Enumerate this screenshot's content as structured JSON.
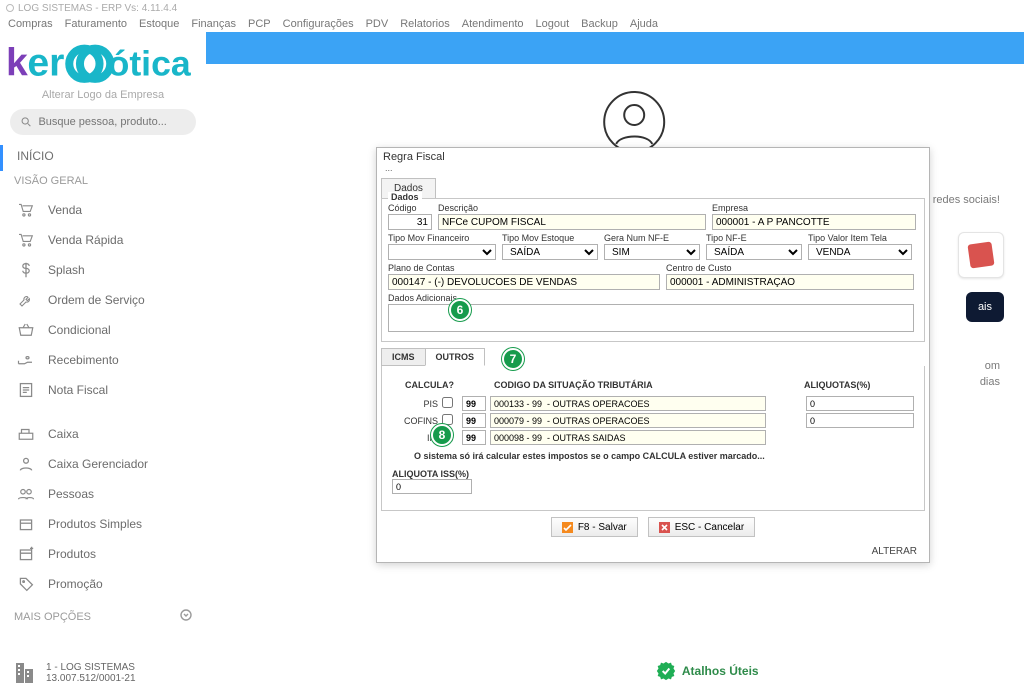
{
  "window_title": "LOG SISTEMAS - ERP Vs: 4.11.4.4",
  "menubar": [
    "Compras",
    "Faturamento",
    "Estoque",
    "Finanças",
    "PCP",
    "Configurações",
    "PDV",
    "Relatorios",
    "Atendimento",
    "Logout",
    "Backup",
    "Ajuda"
  ],
  "sidebar": {
    "alter_logo": "Alterar Logo da Empresa",
    "search_placeholder": "Busque pessoa, produto...",
    "inicio": "INÍCIO",
    "visao_geral": "VISÃO GERAL",
    "items1": [
      {
        "icon": "cart",
        "label": "Venda"
      },
      {
        "icon": "cart",
        "label": "Venda Rápida"
      },
      {
        "icon": "dollar",
        "label": "Splash"
      },
      {
        "icon": "wrench",
        "label": "Ordem de Serviço"
      },
      {
        "icon": "basket",
        "label": "Condicional"
      },
      {
        "icon": "hand-dollar",
        "label": "Recebimento"
      },
      {
        "icon": "receipt",
        "label": "Nota Fiscal"
      }
    ],
    "items2": [
      {
        "icon": "register",
        "label": "Caixa"
      },
      {
        "icon": "person",
        "label": "Caixa Gerenciador"
      },
      {
        "icon": "people",
        "label": "Pessoas"
      },
      {
        "icon": "box",
        "label": "Produtos Simples"
      },
      {
        "icon": "box-plus",
        "label": "Produtos"
      },
      {
        "icon": "tag",
        "label": "Promoção"
      }
    ],
    "mais_opcoes": "MAIS OPÇÕES",
    "footer_company": "1 - LOG SISTEMAS",
    "footer_cnpj": "13.007.512/0001-21"
  },
  "background": {
    "line1": "redes sociais!",
    "line2": "om",
    "line3": "dias",
    "btn": "ais"
  },
  "modal": {
    "title": "Regra Fiscal",
    "sub": "...",
    "tab_main": "Dados",
    "fieldset_title": "Dados",
    "codigo_label": "Código",
    "codigo_value": "31",
    "descricao_label": "Descrição",
    "descricao_value": "NFCe CUPOM FISCAL",
    "empresa_label": "Empresa",
    "empresa_value": "000001 - A P PANCOTTE",
    "tipo_mov_fin_label": "Tipo Mov Financeiro",
    "tipo_mov_fin_value": "",
    "tipo_mov_est_label": "Tipo Mov Estoque",
    "tipo_mov_est_value": "SAÍDA",
    "gera_nfe_label": "Gera Num NF-E",
    "gera_nfe_value": "SIM",
    "tipo_nfe_label": "Tipo NF-E",
    "tipo_nfe_value": "SAÍDA",
    "tipo_valor_item_label": "Tipo Valor Item Tela",
    "tipo_valor_item_value": "VENDA",
    "plano_contas_label": "Plano de Contas",
    "plano_contas_value": "000147 - (-) DEVOLUCOES DE VENDAS",
    "centro_custo_label": "Centro de Custo",
    "centro_custo_value": "000001 - ADMINISTRAÇÃO",
    "dados_adicionais_label": "Dados Adicionais",
    "dados_adicionais_value": "",
    "tab_icms": "ICMS",
    "tab_outros": "OUTROS",
    "col_calcula": "CALCULA?",
    "col_codigo_sit": "CODIGO DA SITUAÇÃO TRIBUTÁRIA",
    "col_aliquotas": "ALIQUOTAS(%)",
    "rows": [
      {
        "label": "PIS",
        "cst_code": "99",
        "cst_desc": "000133 - 99  - OUTRAS OPERACOES",
        "aliq": "0"
      },
      {
        "label": "COFINS",
        "cst_code": "99",
        "cst_desc": "000079 - 99  - OUTRAS OPERACOES",
        "aliq": "0"
      },
      {
        "label": "IPI",
        "cst_code": "99",
        "cst_desc": "000098 - 99  - OUTRAS SAIDAS",
        "aliq": ""
      }
    ],
    "warn": "O sistema só irá calcular estes impostos se o campo CALCULA estiver marcado...",
    "aliquota_iss_label": "ALIQUOTA ISS(%)",
    "aliquota_iss_value": "0",
    "btn_save": "F8 - Salvar",
    "btn_cancel": "ESC - Cancelar",
    "footer_mode": "ALTERAR"
  },
  "callouts": {
    "b6": "6",
    "b7": "7",
    "b8": "8"
  },
  "atalhos": "Atalhos Úteis"
}
